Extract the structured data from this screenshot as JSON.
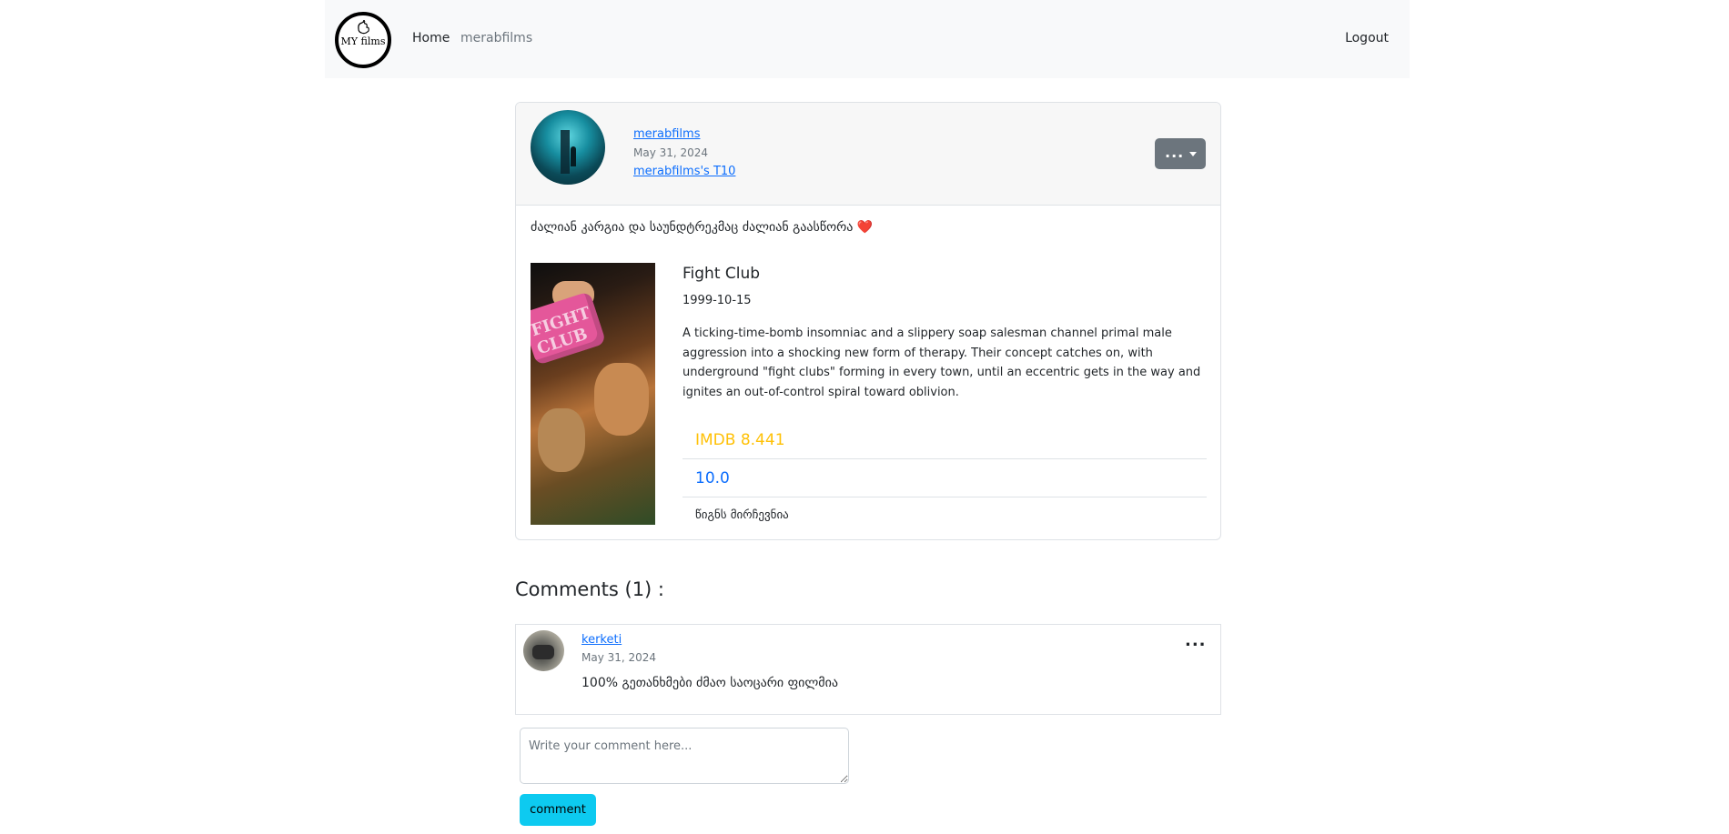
{
  "navbar": {
    "logo_text": "MY films",
    "home": "Home",
    "user": "merabfilms",
    "logout": "Logout"
  },
  "post": {
    "author": "merabfilms",
    "date": "May 31, 2024",
    "list_link": "merabfilms's T10",
    "menu_button": "...",
    "text": "ძალიან კარგია და საუნდტრეკმაც ძალიან გაასწორა",
    "heart": "❤️",
    "movie": {
      "title": "Fight Club",
      "release_date": "1999-10-15",
      "overview": "A ticking-time-bomb insomniac and a slippery soap salesman channel primal male aggression into a shocking new form of therapy. Their concept catches on, with underground \"fight clubs\" forming in every town, until an eccentric gets in the way and ignites an out-of-control spiral toward oblivion.",
      "imdb": "IMDB 8.441",
      "user_rating": "10.0",
      "tag": "წიგნს მირჩევნია"
    }
  },
  "comments": {
    "title": "Comments (1) :",
    "items": [
      {
        "author": "kerketi",
        "date": "May 31, 2024",
        "text": "100% გეთანხმები ძმაო საოცარი ფილმია",
        "menu": "..."
      }
    ],
    "input_placeholder": "Write your comment here...",
    "submit": "comment"
  },
  "colors": {
    "link": "#0d6efd",
    "imdb": "#ffc107",
    "submit_bg": "#0dcaf0",
    "menu_button_bg": "#6c757d"
  }
}
